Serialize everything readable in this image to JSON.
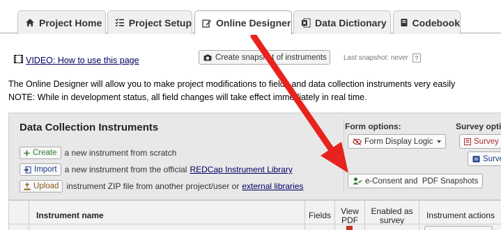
{
  "tabs": [
    {
      "label": "Project Home",
      "icon": "home-icon"
    },
    {
      "label": "Project Setup",
      "icon": "checklist-icon"
    },
    {
      "label": "Online Designer",
      "icon": "edit-icon",
      "active": true
    },
    {
      "label": "Data Dictionary",
      "icon": "excel-icon"
    },
    {
      "label": "Codebook",
      "icon": "book-icon"
    }
  ],
  "video_link": "VIDEO: How to use this page",
  "snapshot_button": "Create snapshot of instruments",
  "last_snapshot": "Last snapshot: never",
  "help_mark": "?",
  "intro": {
    "line1": "The Online Designer will allow you to make project modifications to fields and data collection instruments very easily",
    "line2": "NOTE: While in development status, all field changes will take effect immediately in real time."
  },
  "instruments": {
    "title": "Data Collection Instruments",
    "create_button": "Create",
    "create_text": "a new instrument from scratch",
    "import_button": "Import",
    "import_text": "a new instrument from the official",
    "import_link": "REDCap Instrument Library",
    "upload_button": "Upload",
    "upload_text": "instrument ZIP file from another project/user or",
    "upload_link": "external libraries",
    "form_options_label": "Form options:",
    "form_display_logic": "Form Display Logic",
    "econsent_button": "e-Consent and  PDF Snapshots",
    "survey_options_label": "Survey opti",
    "survey_btn1": "Survey",
    "survey_btn2": "Survey"
  },
  "table_headers": {
    "name": "Instrument name",
    "fields": "Fields",
    "view_pdf": "View PDF",
    "enabled_survey": "Enabled as survey",
    "actions": "Instrument actions"
  },
  "colors": {
    "arrow": "#e8231d",
    "panel_bg": "#e8e8e8",
    "link": "#000066"
  }
}
